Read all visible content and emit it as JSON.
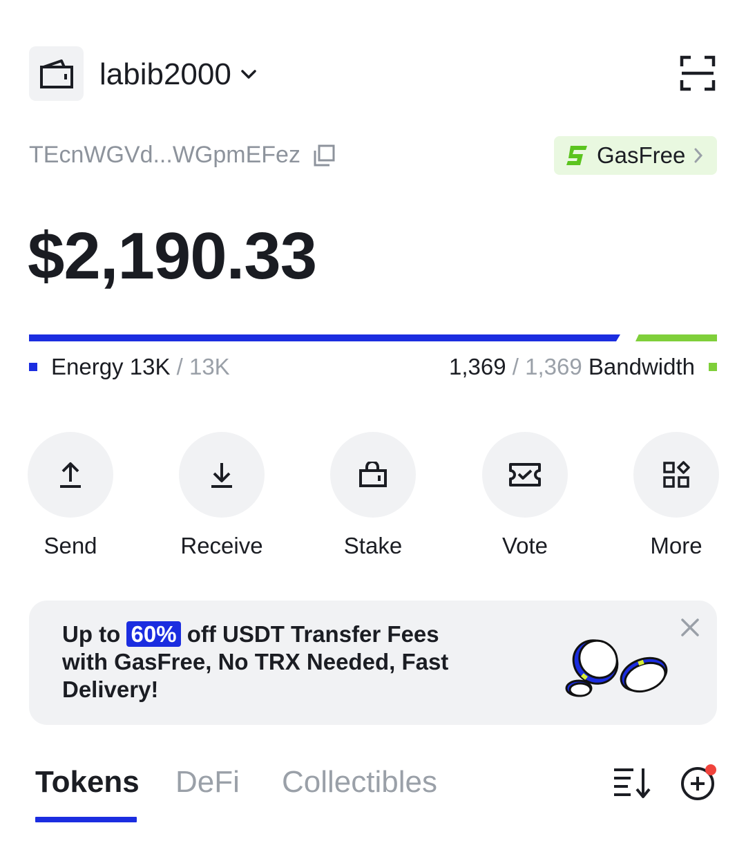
{
  "header": {
    "wallet_name": "labib2000",
    "wallet_icon": "wallet-icon",
    "dropdown_icon": "chevron-down-icon",
    "scan_icon": "scan-icon"
  },
  "address": {
    "short": "TEcnWGVd...WGpmEFez",
    "copy_icon": "copy-icon"
  },
  "gasfree_badge": {
    "label": "GasFree",
    "icon": "gasfree-logo-icon",
    "chevron_icon": "chevron-right-icon"
  },
  "balance": "$2,190.33",
  "resources": {
    "energy_label": "Energy",
    "energy_current": "13K",
    "energy_max": "13K",
    "separator": "/",
    "bandwidth_label": "Bandwidth",
    "bandwidth_current": "1,369",
    "bandwidth_max": "1,369",
    "energy_color": "#1b2de0",
    "bandwidth_color": "#7fcf3a"
  },
  "actions": [
    {
      "label": "Send",
      "icon": "upload-arrow-icon"
    },
    {
      "label": "Receive",
      "icon": "download-arrow-icon"
    },
    {
      "label": "Stake",
      "icon": "lock-bag-icon"
    },
    {
      "label": "Vote",
      "icon": "ticket-check-icon"
    },
    {
      "label": "More",
      "icon": "grid-more-icon"
    }
  ],
  "promo": {
    "pre": "Up to",
    "highlight": "60%",
    "post": "off USDT Transfer Fees with GasFree, No TRX Needed, Fast Delivery!",
    "close_icon": "close-icon"
  },
  "tabs": [
    {
      "label": "Tokens",
      "active": true
    },
    {
      "label": "DeFi",
      "active": false
    },
    {
      "label": "Collectibles",
      "active": false
    }
  ],
  "toolbar": {
    "sort_icon": "sort-icon",
    "add_icon": "add-token-icon"
  },
  "colors": {
    "accent": "#1b2de0",
    "green": "#7fcf3a",
    "notification_dot": "#f0433c"
  }
}
